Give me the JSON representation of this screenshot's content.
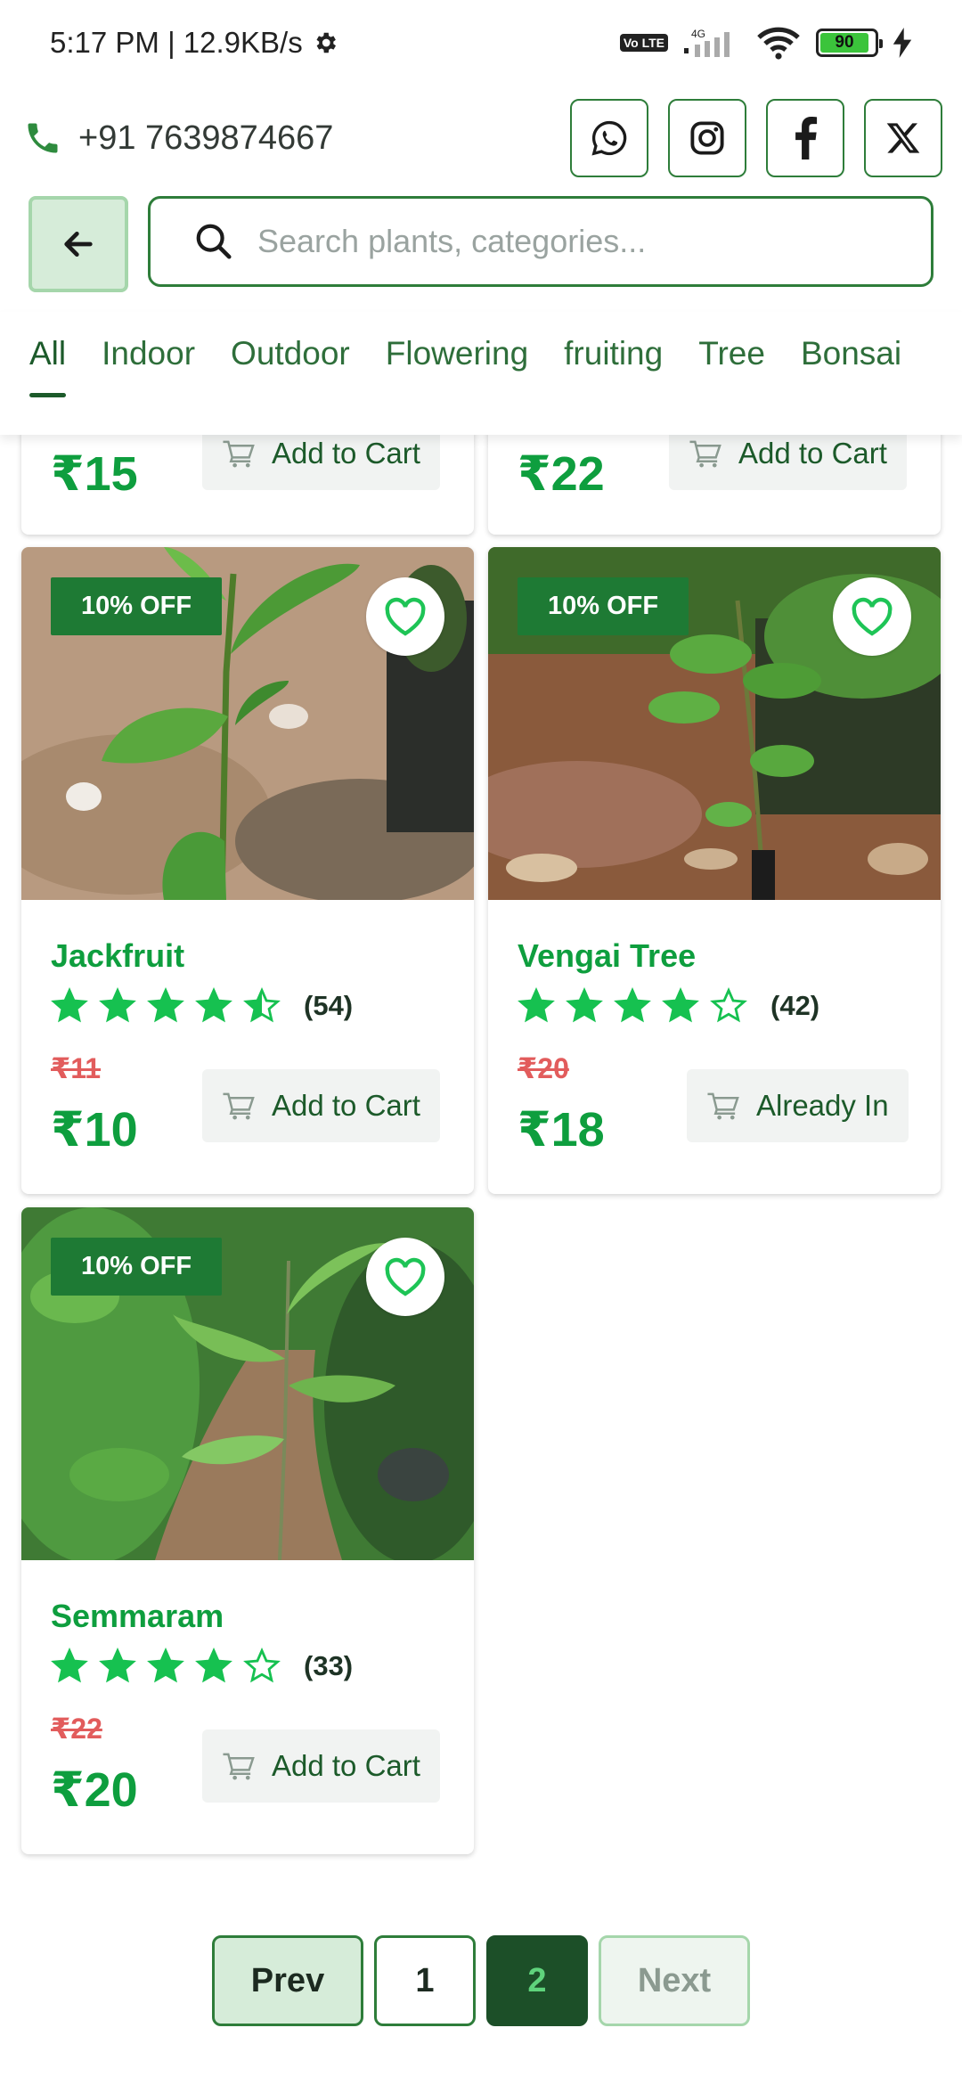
{
  "status_bar": {
    "time_speed": "5:17 PM | 12.9KB/s",
    "network": "4G",
    "volte": "Vo LTE",
    "battery": "90"
  },
  "contact": {
    "phone": "+91 7639874667",
    "socials": [
      "whatsapp-icon",
      "instagram-icon",
      "facebook-icon",
      "x-icon"
    ]
  },
  "search": {
    "placeholder": "Search plants, categories..."
  },
  "tabs": [
    "All",
    "Indoor",
    "Outdoor",
    "Flowering",
    "fruiting",
    "Tree",
    "Bonsai"
  ],
  "active_tab": "All",
  "partial_row": [
    {
      "price": "₹15",
      "cart_label": "Add to Cart"
    },
    {
      "price": "₹22",
      "cart_label": "Add to Cart"
    }
  ],
  "products": [
    {
      "badge": "10% OFF",
      "name": "Jackfruit",
      "rating": 4.5,
      "reviews": "(54)",
      "old_price": "₹11",
      "price": "₹10",
      "cart_label": "Add to Cart"
    },
    {
      "badge": "10% OFF",
      "name": "Vengai Tree",
      "rating": 4,
      "reviews": "(42)",
      "old_price": "₹20",
      "price": "₹18",
      "cart_label": "Already In"
    },
    {
      "badge": "10% OFF",
      "name": "Semmaram",
      "rating": 4,
      "reviews": "(33)",
      "old_price": "₹22",
      "price": "₹20",
      "cart_label": "Add to Cart"
    }
  ],
  "pagination": {
    "prev": "Prev",
    "pages": [
      "1",
      "2"
    ],
    "current": "2",
    "next": "Next"
  },
  "colors": {
    "brand_green": "#1e7a34",
    "price_green": "#0e9e3e",
    "strike_red": "#e25c5c"
  }
}
